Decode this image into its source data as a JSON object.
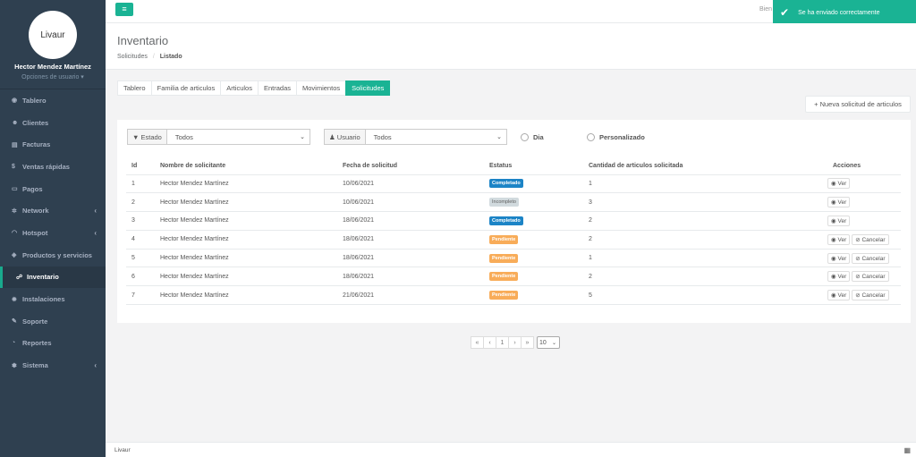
{
  "sidebar": {
    "logo_text": "Livaur",
    "user_name": "Hector Mendez Martínez",
    "user_options": "Opciones de usuario ▾",
    "items": [
      {
        "label": "Tablero",
        "icon": "dashboard-icon",
        "glyph": "◉"
      },
      {
        "label": "Clientes",
        "icon": "users-icon",
        "glyph": "☻"
      },
      {
        "label": "Facturas",
        "icon": "invoice-icon",
        "glyph": "▤"
      },
      {
        "label": "Ventas rápidas",
        "icon": "dollar-icon",
        "glyph": "$"
      },
      {
        "label": "Pagos",
        "icon": "money-icon",
        "glyph": "▭"
      },
      {
        "label": "Network",
        "icon": "network-icon",
        "glyph": "✲",
        "chevron": "‹"
      },
      {
        "label": "Hotspot",
        "icon": "wifi-icon",
        "glyph": "◠",
        "chevron": "‹"
      },
      {
        "label": "Productos y servicios",
        "icon": "tag-icon",
        "glyph": "◈"
      },
      {
        "label": "Inventario",
        "icon": "cubes-icon",
        "glyph": "☍"
      },
      {
        "label": "Instalaciones",
        "icon": "gears-icon",
        "glyph": "✹"
      },
      {
        "label": "Soporte",
        "icon": "wrench-icon",
        "glyph": "✎"
      },
      {
        "label": "Reportes",
        "icon": "chart-icon",
        "glyph": "◔"
      },
      {
        "label": "Sistema",
        "icon": "cogs-icon",
        "glyph": "✽",
        "chevron": "‹"
      }
    ]
  },
  "topbar": {
    "menu_glyph": "≡",
    "welcome": "Bien",
    "toast": "Se ha enviado correctamente",
    "toast_glyph": "✔"
  },
  "header": {
    "title": "Inventario",
    "crumb1": "Solicitudes",
    "crumb_sep": "/",
    "crumb2": "Listado"
  },
  "tabs": [
    "Tablero",
    "Familia de articulos",
    "Articulos",
    "Entradas",
    "Movimientos",
    "Solicitudes"
  ],
  "new_button": "+ Nueva solicitud de articulos",
  "filters": {
    "estado_label": "▼ Estado",
    "estado_value": "Todos",
    "usuario_label": "♟ Usuario",
    "usuario_value": "Todos",
    "radio_dia": "Dia",
    "radio_personalizado": "Personalizado"
  },
  "table": {
    "headers": [
      "Id",
      "Nombre de solicitante",
      "Fecha de solicitud",
      "Estatus",
      "Cantidad de articulos solicitada",
      "Acciones"
    ],
    "rows": [
      {
        "id": "1",
        "nombre": "Hector Mendez Martínez",
        "fecha": "10/06/2021",
        "estatus": "Completado",
        "cantidad": "1"
      },
      {
        "id": "2",
        "nombre": "Hector Mendez Martínez",
        "fecha": "10/06/2021",
        "estatus": "Incompleto",
        "cantidad": "3"
      },
      {
        "id": "3",
        "nombre": "Hector Mendez Martínez",
        "fecha": "18/06/2021",
        "estatus": "Completado",
        "cantidad": "2"
      },
      {
        "id": "4",
        "nombre": "Hector Mendez Martínez",
        "fecha": "18/06/2021",
        "estatus": "Pendiente",
        "cantidad": "2"
      },
      {
        "id": "5",
        "nombre": "Hector Mendez Martínez",
        "fecha": "18/06/2021",
        "estatus": "Pendiente",
        "cantidad": "1"
      },
      {
        "id": "6",
        "nombre": "Hector Mendez Martínez",
        "fecha": "18/06/2021",
        "estatus": "Pendiente",
        "cantidad": "2"
      },
      {
        "id": "7",
        "nombre": "Hector Mendez Martínez",
        "fecha": "21/06/2021",
        "estatus": "Pendiente",
        "cantidad": "5"
      }
    ],
    "ver_label": "◉ Ver",
    "cancelar_label": "⊘ Cancelar"
  },
  "pagination": {
    "first": "«",
    "prev": "‹",
    "page": "1",
    "next": "›",
    "last": "»",
    "page_size": "10"
  },
  "footer": {
    "text": "Livaur",
    "icon_glyph": "▦"
  },
  "colors": {
    "accent": "#1ab394",
    "sidebar": "#2f4050",
    "completado": "#1c84c6",
    "pendiente": "#f8ac59",
    "incompleto": "#d1dade"
  }
}
